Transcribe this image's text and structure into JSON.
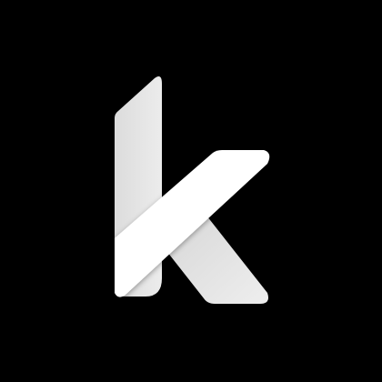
{
  "logo": {
    "letter": "k",
    "icon": "k-letter-logo-icon",
    "background_color": "#000000",
    "colors": {
      "stem": "#e6e6e6",
      "leg": "#e8e8e8",
      "arm": "#ffffff"
    }
  }
}
